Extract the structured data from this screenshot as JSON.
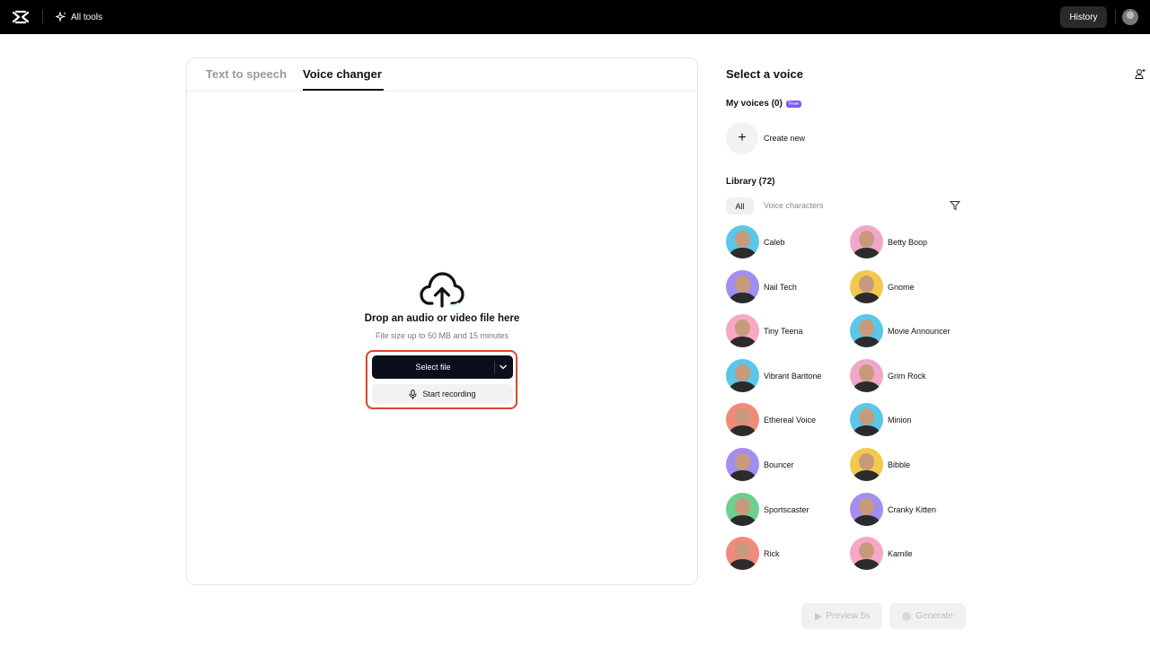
{
  "topbar": {
    "all_tools": "All tools",
    "history": "History"
  },
  "tabs": [
    {
      "label": "Text to speech",
      "active": false
    },
    {
      "label": "Voice changer",
      "active": true
    }
  ],
  "upload": {
    "title": "Drop an audio or video file here",
    "subtitle": "File size up to 50 MB and 15 minutes",
    "select_file": "Select file",
    "start_recording": "Start recording"
  },
  "voices_panel": {
    "title": "Select a voice",
    "my_voices": "My voices (0)",
    "free_badge": "Free",
    "create_new": "Create new",
    "library": "Library (72)",
    "filters": [
      "All",
      "Voice characters"
    ],
    "items": [
      {
        "name": "Caleb",
        "color": "#5bc6e8"
      },
      {
        "name": "Betty Boop",
        "color": "#f1a7c9"
      },
      {
        "name": "Nail Tech",
        "color": "#a48df0"
      },
      {
        "name": "Gnome",
        "color": "#f2c94c"
      },
      {
        "name": "Tiny Teena",
        "color": "#f7a8c4"
      },
      {
        "name": "Movie Announcer",
        "color": "#5bc6e8"
      },
      {
        "name": "Vibrant Baritone",
        "color": "#5bc6e8"
      },
      {
        "name": "Grim Rock",
        "color": "#f1a7c9"
      },
      {
        "name": "Ethereal Voice",
        "color": "#f08a7a"
      },
      {
        "name": "Minion",
        "color": "#5bc6e8"
      },
      {
        "name": "Bouncer",
        "color": "#a48df0"
      },
      {
        "name": "Bibble",
        "color": "#f2c94c"
      },
      {
        "name": "Sportscaster",
        "color": "#6fd08c"
      },
      {
        "name": "Cranky Kitten",
        "color": "#a48df0"
      },
      {
        "name": "Rick",
        "color": "#f08a7a"
      },
      {
        "name": "Kamile",
        "color": "#f7a8c4"
      }
    ]
  },
  "footer": {
    "preview": "Preview 5s",
    "generate": "Generate"
  },
  "colors": {
    "accent_dark": "#0b0f19",
    "highlight": "#e0412d",
    "badge": "#7d5bf6"
  }
}
